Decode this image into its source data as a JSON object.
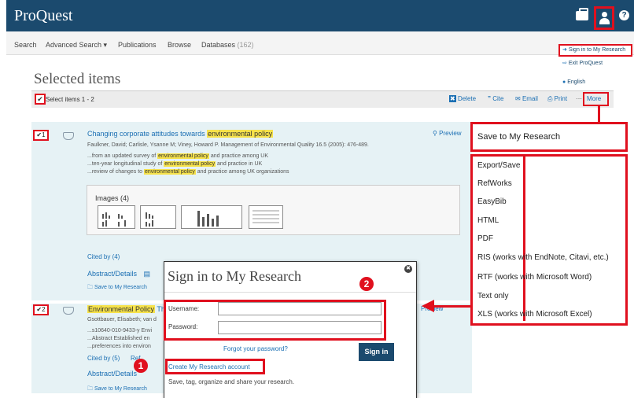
{
  "header": {
    "logo": "ProQuest",
    "help_glyph": "?"
  },
  "nav": {
    "items": [
      "Search",
      "Advanced Search ▾",
      "Publications",
      "Browse",
      "Databases"
    ],
    "databases_count": "(162)"
  },
  "user_menu": {
    "sign_in": "Sign in to My Research",
    "exit": "Exit ProQuest",
    "language": "English"
  },
  "page": {
    "title": "Selected items",
    "select_label": "Select items 1 - 2",
    "actions": {
      "delete": "Delete",
      "cite": "Cite",
      "email": "Email",
      "print": "Print",
      "more": "More"
    }
  },
  "results": [
    {
      "number": "1",
      "title_pre": "Changing corporate attitudes towards ",
      "title_hl": "environmental policy",
      "meta": "Faulkner, David; Carlisle, Ysanne M; Viney, Howard P. Management of Environmental Quality 16.5  (2005): 476-489.",
      "snippets": [
        {
          "pre": "...from an updated survey of ",
          "hl": "environmental policy",
          "post": " and practice among UK"
        },
        {
          "pre": "...ten-year longitudinal study of ",
          "hl": "environmental policy",
          "post": " and practice in UK"
        },
        {
          "pre": "...review of changes to ",
          "hl": "environmental policy",
          "post": " and practice among UK organizations"
        }
      ],
      "preview": "Preview",
      "images_label": "Images (4)",
      "cited_by": "Cited by (4)",
      "abstract": "Abstract/Details",
      "save": "Save to My Research"
    },
    {
      "number": "2",
      "title_hl": "Environmental Policy",
      "title_post": " Th",
      "meta": "Gsottbauer, Elisabeth; van d",
      "snippets": [
        "...s10640-010-9433-y Envi",
        "...Abstract Established en",
        "...preferences into environ"
      ],
      "preview": "Preview",
      "cited_by": "Cited by (5)",
      "references": "Ref",
      "abstract": "Abstract/Details",
      "save": "Save to My Research"
    }
  ],
  "more_menu": {
    "save": "Save to My Research",
    "items": [
      "Export/Save",
      "RefWorks",
      "EasyBib",
      "HTML",
      "PDF",
      "RIS (works with EndNote, Citavi, etc.)",
      "RTF (works with Microsoft Word)",
      "Text only",
      "XLS (works with Microsoft Excel)"
    ]
  },
  "modal": {
    "title": "Sign in to My Research",
    "username_label": "Username:",
    "password_label": "Password:",
    "forgot": "Forgot your password?",
    "sign_in_button": "Sign in",
    "create_account": "Create My Research account",
    "tagline": "Save, tag, organize and share your research.",
    "close_glyph": "✖"
  },
  "annotations": {
    "step1": "1",
    "step2": "2",
    "highlight_color": "#e0101e"
  },
  "colors": {
    "header_bg": "#1b4a6e",
    "link": "#1b6fb3",
    "highlight": "#f6e24b",
    "result_bg": "#e6f2f5"
  }
}
